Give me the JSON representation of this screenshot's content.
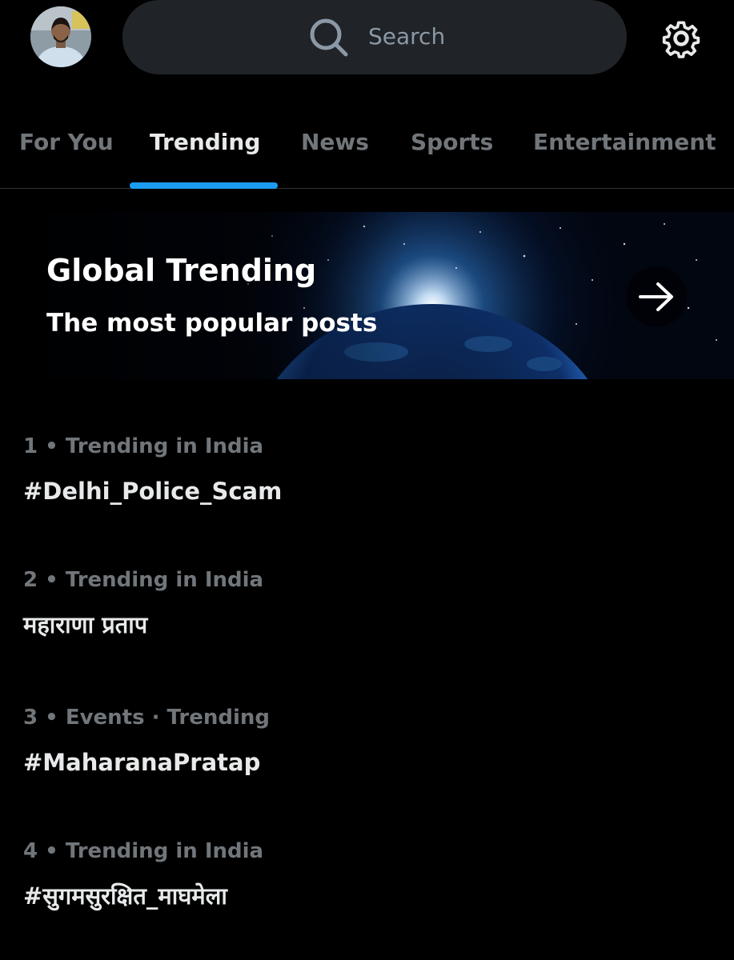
{
  "header": {
    "search_placeholder": "Search"
  },
  "tabs": [
    {
      "label": "For You",
      "active": false
    },
    {
      "label": "Trending",
      "active": true
    },
    {
      "label": "News",
      "active": false
    },
    {
      "label": "Sports",
      "active": false
    },
    {
      "label": "Entertainment",
      "active": false
    }
  ],
  "banner": {
    "title": "Global Trending",
    "subtitle": "The most popular posts"
  },
  "trends": [
    {
      "meta": "1 • Trending in India",
      "name": "#Delhi_Police_Scam"
    },
    {
      "meta": "2 • Trending in India",
      "name": "महाराणा प्रताप"
    },
    {
      "meta": "3 • Events · Trending",
      "name": "#MaharanaPratap"
    },
    {
      "meta": "4 • Trending in India",
      "name": "#सुगमसुरक्षित_माघमेला"
    }
  ],
  "colors": {
    "background": "#000000",
    "search_bg": "#202327",
    "accent": "#1d9bf0",
    "text_primary": "#e7e9ea",
    "text_secondary": "#71767b"
  },
  "icons": {
    "avatar": "user-avatar",
    "search": "search-icon",
    "settings": "gear-icon",
    "banner_action": "arrow-right-icon"
  }
}
